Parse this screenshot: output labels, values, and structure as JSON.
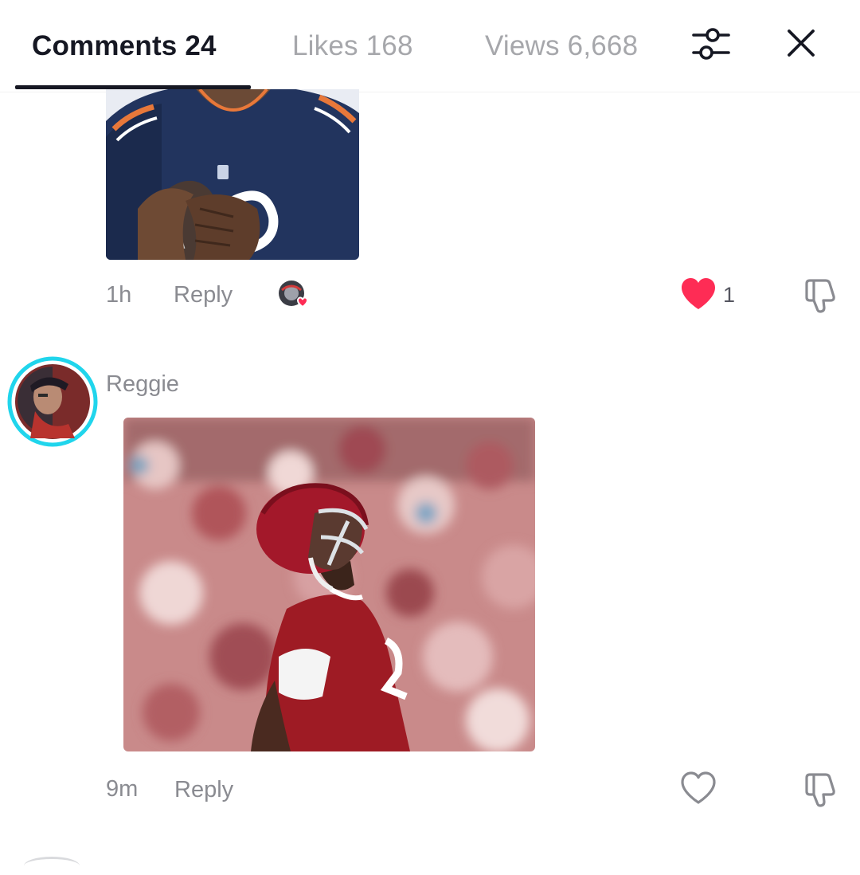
{
  "tabs": {
    "comments": "Comments 24",
    "likes": "Likes 168",
    "views": "Views 6,668"
  },
  "header_icons": [
    "filter-icon",
    "close-icon"
  ],
  "comments": [
    {
      "username": "",
      "image": "football player in navy jersey holding a football",
      "time": "1h",
      "reply_label": "Reply",
      "creator_liked": true,
      "liked": true,
      "like_count": "1"
    },
    {
      "username": "Reggie",
      "image": "football player in crimson jersey and helmet looking up in a stadium",
      "time": "9m",
      "reply_label": "Reply",
      "creator_liked": false,
      "liked": false,
      "like_count": ""
    }
  ],
  "colors": {
    "primary_text": "#161823",
    "secondary_text": "#8a8b91",
    "inactive_tab": "#a6a7ab",
    "like_red": "#fe2c55",
    "avatar_ring": "#20d5ec"
  }
}
